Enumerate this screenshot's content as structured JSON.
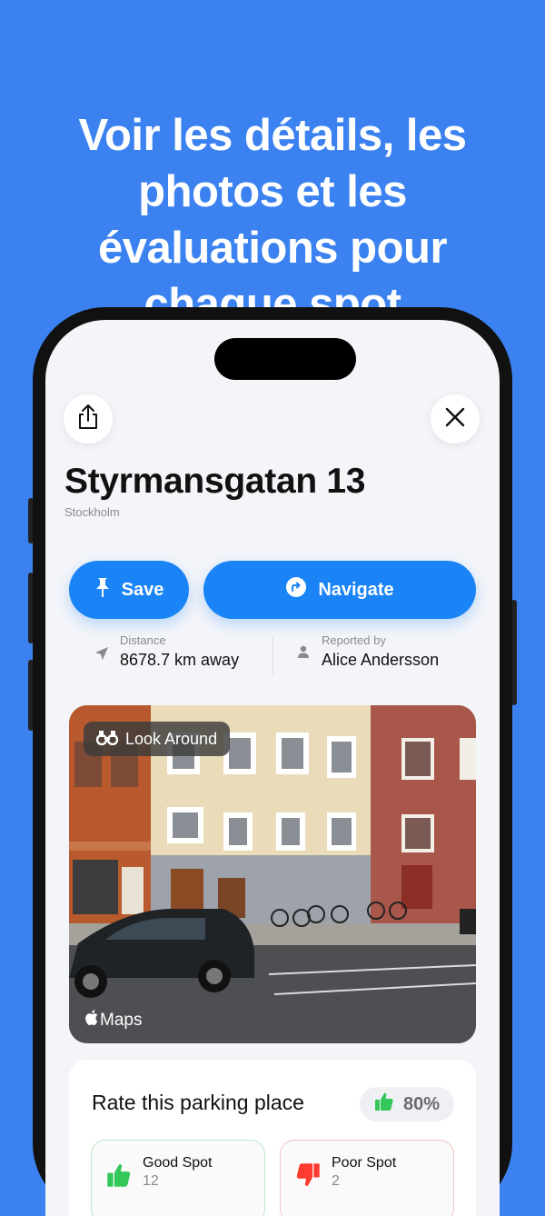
{
  "marketing": {
    "headline": "Voir les détails, les photos et les évaluations pour chaque spot"
  },
  "spot": {
    "title": "Styrmansgatan 13",
    "city": "Stockholm"
  },
  "actions": {
    "save_label": "Save",
    "navigate_label": "Navigate"
  },
  "info": {
    "distance_label": "Distance",
    "distance_value": "8678.7 km away",
    "reported_label": "Reported by",
    "reported_value": "Alice Andersson"
  },
  "photo": {
    "look_around_label": "Look Around",
    "maps_label": "Maps"
  },
  "rating": {
    "title": "Rate this parking place",
    "percentage": "80%",
    "good_label": "Good Spot",
    "good_count": "12",
    "poor_label": "Poor Spot",
    "poor_count": "2"
  },
  "colors": {
    "background": "#3b82f0",
    "accent": "#1a84f7",
    "good": "#34c759",
    "poor": "#ff3b30"
  }
}
